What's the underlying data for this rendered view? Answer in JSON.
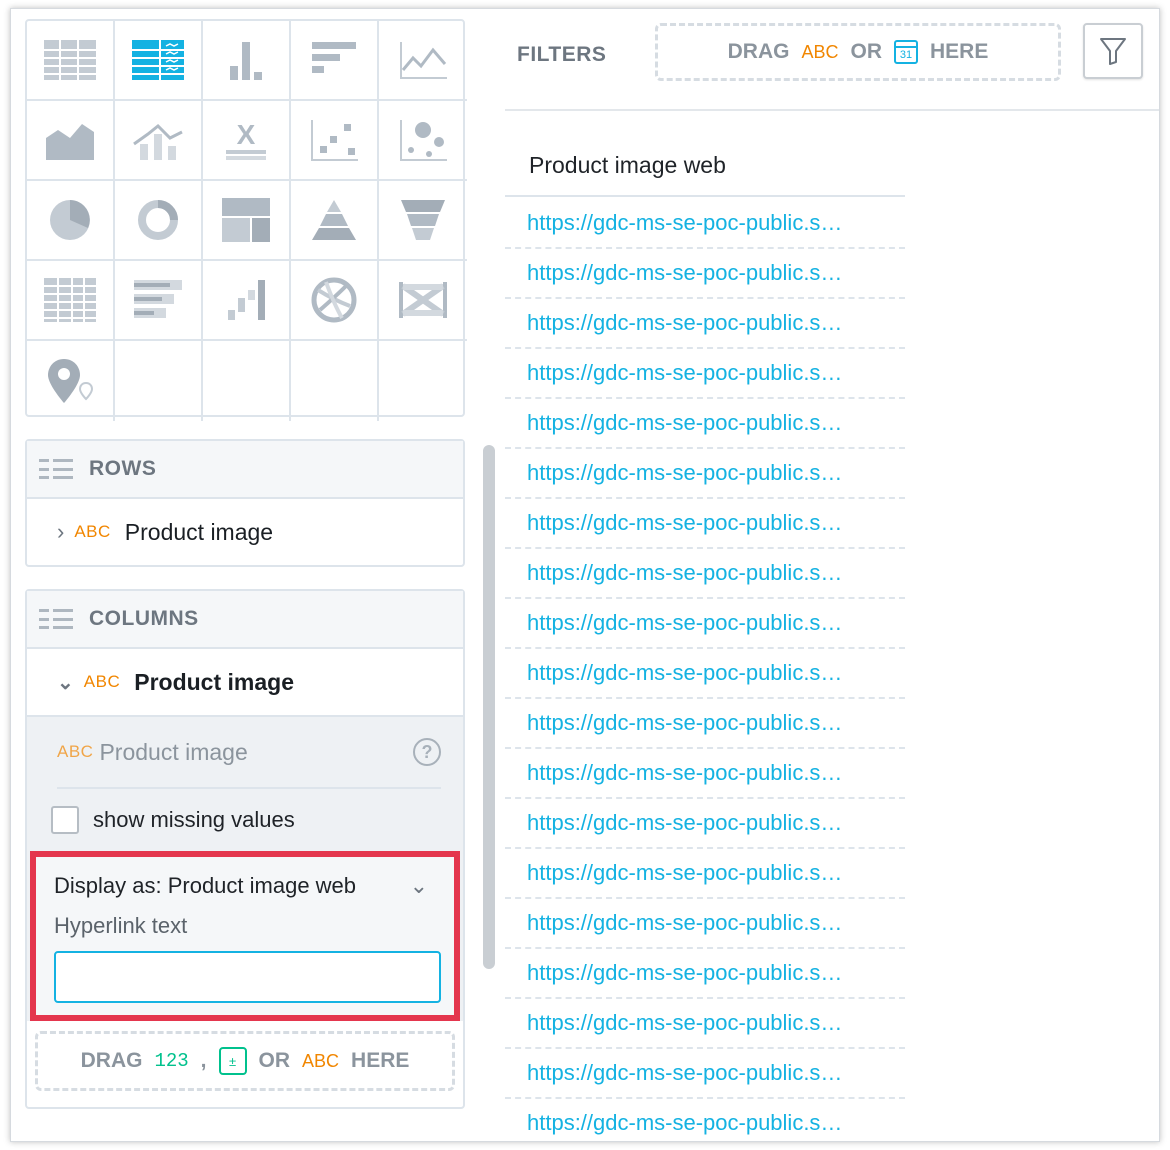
{
  "visualization_types": [
    {
      "name": "table",
      "icon": "table-icon",
      "selected": false
    },
    {
      "name": "pivot",
      "icon": "pivot-table-icon",
      "selected": true
    },
    {
      "name": "column",
      "icon": "column-chart-icon"
    },
    {
      "name": "bar",
      "icon": "bar-chart-icon"
    },
    {
      "name": "line",
      "icon": "line-chart-icon"
    },
    {
      "name": "area",
      "icon": "area-chart-icon"
    },
    {
      "name": "combo",
      "icon": "combo-chart-icon"
    },
    {
      "name": "headline",
      "icon": "headline-icon"
    },
    {
      "name": "scatter",
      "icon": "scatter-plot-icon"
    },
    {
      "name": "bubble",
      "icon": "bubble-chart-icon"
    },
    {
      "name": "pie",
      "icon": "pie-chart-icon"
    },
    {
      "name": "donut",
      "icon": "donut-chart-icon"
    },
    {
      "name": "treemap",
      "icon": "treemap-icon"
    },
    {
      "name": "pyramid",
      "icon": "pyramid-chart-icon"
    },
    {
      "name": "funnel",
      "icon": "funnel-chart-icon"
    },
    {
      "name": "heatmap",
      "icon": "heatmap-icon"
    },
    {
      "name": "bullet",
      "icon": "bullet-chart-icon"
    },
    {
      "name": "waterfall",
      "icon": "waterfall-chart-icon"
    },
    {
      "name": "dependency-wheel",
      "icon": "dependency-wheel-icon"
    },
    {
      "name": "sankey",
      "icon": "sankey-chart-icon"
    },
    {
      "name": "geo",
      "icon": "geo-pushpin-icon"
    }
  ],
  "rows_bucket": {
    "title": "ROWS",
    "item": {
      "type_label": "ABC",
      "label": "Product image"
    }
  },
  "columns_bucket": {
    "title": "COLUMNS",
    "item": {
      "type_label": "ABC",
      "label": "Product image"
    },
    "attribute": {
      "type_label": "ABC",
      "label": "Product image"
    },
    "help_glyph": "?",
    "show_missing_label": "show missing values",
    "display_as_label": "Display as: Product image web",
    "hyperlink_label": "Hyperlink text",
    "hyperlink_value": ""
  },
  "drop_zone": {
    "drag": "DRAG",
    "num": "123",
    "comma": ",",
    "or": "OR",
    "abc": "ABC",
    "here": "HERE"
  },
  "filters": {
    "label": "FILTERS",
    "drag": "DRAG",
    "abc": "ABC",
    "or": "OR",
    "cal_day": "31",
    "here": "HERE"
  },
  "table": {
    "header": "Product image web",
    "rows": [
      "https://gdc-ms-se-poc-public.s…",
      "https://gdc-ms-se-poc-public.s…",
      "https://gdc-ms-se-poc-public.s…",
      "https://gdc-ms-se-poc-public.s…",
      "https://gdc-ms-se-poc-public.s…",
      "https://gdc-ms-se-poc-public.s…",
      "https://gdc-ms-se-poc-public.s…",
      "https://gdc-ms-se-poc-public.s…",
      "https://gdc-ms-se-poc-public.s…",
      "https://gdc-ms-se-poc-public.s…",
      "https://gdc-ms-se-poc-public.s…",
      "https://gdc-ms-se-poc-public.s…",
      "https://gdc-ms-se-poc-public.s…",
      "https://gdc-ms-se-poc-public.s…",
      "https://gdc-ms-se-poc-public.s…",
      "https://gdc-ms-se-poc-public.s…",
      "https://gdc-ms-se-poc-public.s…",
      "https://gdc-ms-se-poc-public.s…",
      "https://gdc-ms-se-poc-public.s…"
    ]
  },
  "colors": {
    "link": "#14b2e2",
    "attribute_orange": "#f18600",
    "metric_green": "#00c18d",
    "highlight_red": "#e4364e",
    "icon_gray": "#b0bac4",
    "icon_active": "#14b2e2"
  }
}
